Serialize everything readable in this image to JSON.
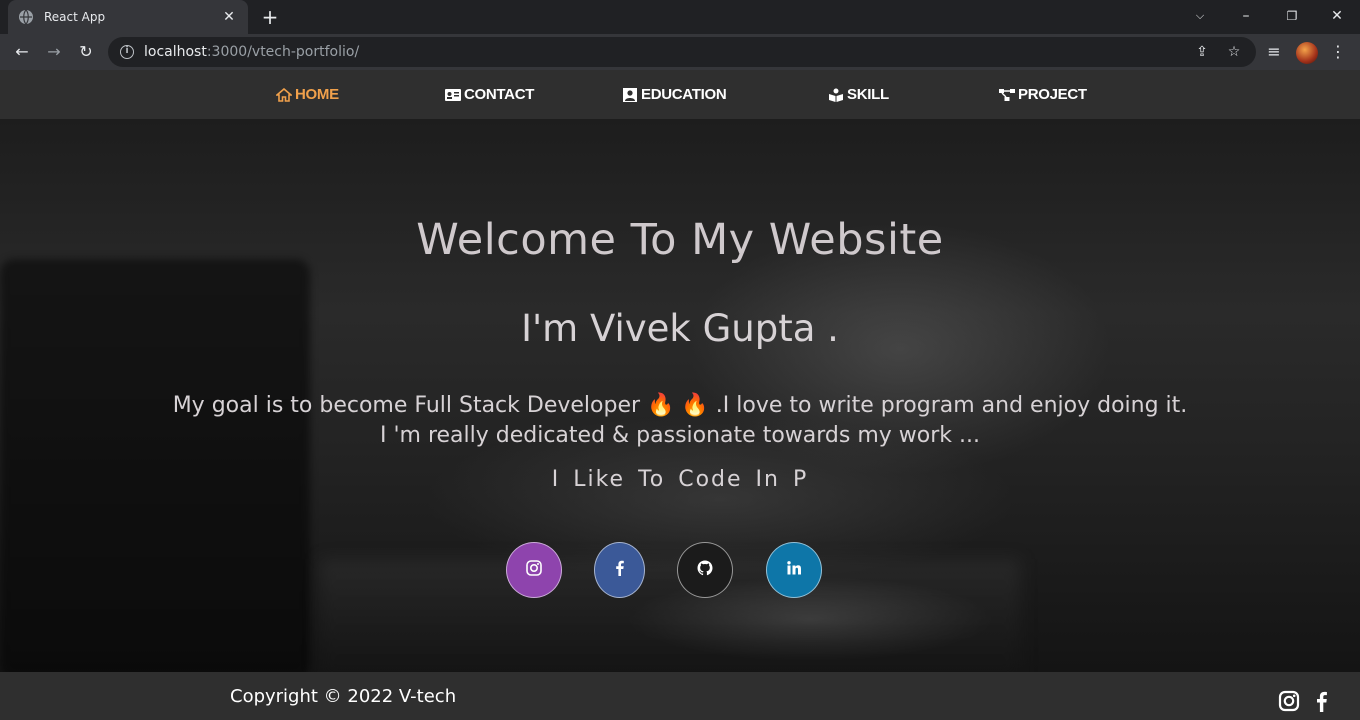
{
  "browser": {
    "tab_title": "React App",
    "url_host": "localhost",
    "url_path": ":3000/vtech-portfolio/"
  },
  "navbar": {
    "items": [
      {
        "label": "HOME",
        "icon": "home-icon",
        "active": true
      },
      {
        "label": "CONTACT",
        "icon": "address-card-icon",
        "active": false
      },
      {
        "label": "EDUCATION",
        "icon": "graduate-icon",
        "active": false
      },
      {
        "label": "SKILL",
        "icon": "book-reader-icon",
        "active": false
      },
      {
        "label": "PROJECT",
        "icon": "project-diagram-icon",
        "active": false
      }
    ],
    "active_color": "#f0a04b"
  },
  "hero": {
    "title": "Welcome To My Website",
    "subtitle": "I'm Vivek Gupta .",
    "goal_line1": "My goal is to become Full Stack Developer 🔥 🔥 .I love to write program and enjoy doing it.",
    "goal_line2": "I 'm really dedicated & passionate towards my work ...",
    "typing_text": "I Like To Code In P"
  },
  "social": [
    {
      "name": "instagram",
      "icon": "instagram-icon",
      "color": "#8e44ad"
    },
    {
      "name": "facebook",
      "icon": "facebook-icon",
      "color": "#3b5998"
    },
    {
      "name": "github",
      "icon": "github-icon",
      "color": "#1b1b1b"
    },
    {
      "name": "linkedin",
      "icon": "linkedin-icon",
      "color": "#0e76a8"
    }
  ],
  "footer": {
    "copyright": "Copyright © 2022 V-tech",
    "icons": [
      "instagram-icon",
      "facebook-icon"
    ]
  }
}
